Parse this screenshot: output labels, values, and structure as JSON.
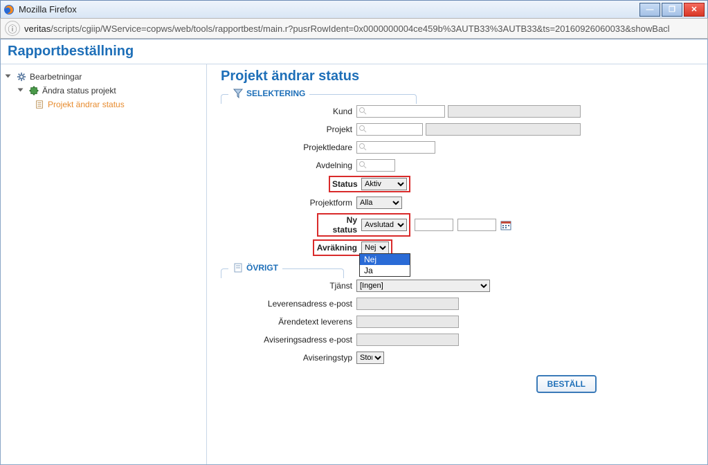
{
  "window": {
    "title": "Mozilla Firefox"
  },
  "address": {
    "host": "veritas",
    "path": "/scripts/cgiip/WService=copws/web/tools/rapportbest/main.r?pusrRowIdent=0x0000000004ce459b%3AUTB33%3AUTB33&ts=20160926060033&showBacl"
  },
  "app_title": "Rapportbeställning",
  "tree": {
    "root": "Bearbetningar",
    "child": "Ändra status projekt",
    "leaf": "Projekt ändrar status"
  },
  "heading": "Projekt ändrar status",
  "sections": {
    "selektering": "SELEKTERING",
    "ovrigt": "ÖVRIGT"
  },
  "labels": {
    "kund": "Kund",
    "projekt": "Projekt",
    "projektledare": "Projektledare",
    "avdelning": "Avdelning",
    "status": "Status",
    "projektform": "Projektform",
    "ny_status": "Ny status",
    "avrakning": "Avräkning",
    "tjanst": "Tjänst",
    "leveransadress": "Leverensadress e-post",
    "arende": "Ärendetext leverens",
    "aviseringsadress": "Aviseringsadress e-post",
    "aviseringstyp": "Aviseringstyp"
  },
  "values": {
    "status": "Aktiv",
    "projektform": "Alla",
    "ny_status": "Avslutad",
    "avrakning": "Nej",
    "avrakning_options": {
      "opt1": "Nej",
      "opt2": "Ja"
    },
    "tjanst": "[Ingen]",
    "aviseringstyp": "Stor"
  },
  "buttons": {
    "bestall": "BESTÄLL"
  }
}
